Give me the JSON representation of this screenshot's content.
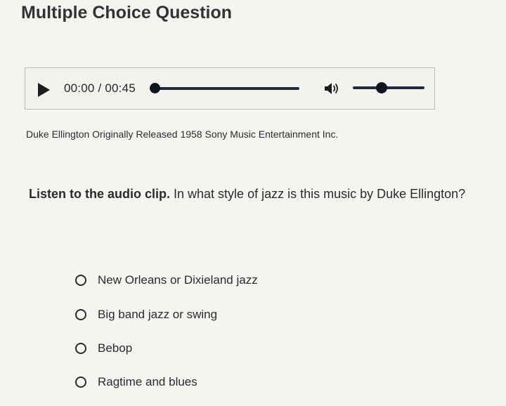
{
  "page": {
    "title": "Multiple Choice Question"
  },
  "audio_player": {
    "current_time": "00:00",
    "separator": "/",
    "duration": "00:45",
    "progress": 0.0,
    "volume": 0.4,
    "play_icon": "play-icon",
    "volume_icon": "volume-icon"
  },
  "credit": "Duke Ellington Originally Released 1958 Sony Music Entertainment Inc.",
  "question": {
    "bold_text": "Listen to the audio clip.",
    "text": " In what style of jazz is this music by Duke Ellington?"
  },
  "options": [
    {
      "label": "New Orleans or Dixieland jazz"
    },
    {
      "label": "Big band jazz or swing"
    },
    {
      "label": "Bebop"
    },
    {
      "label": "Ragtime and blues"
    }
  ]
}
